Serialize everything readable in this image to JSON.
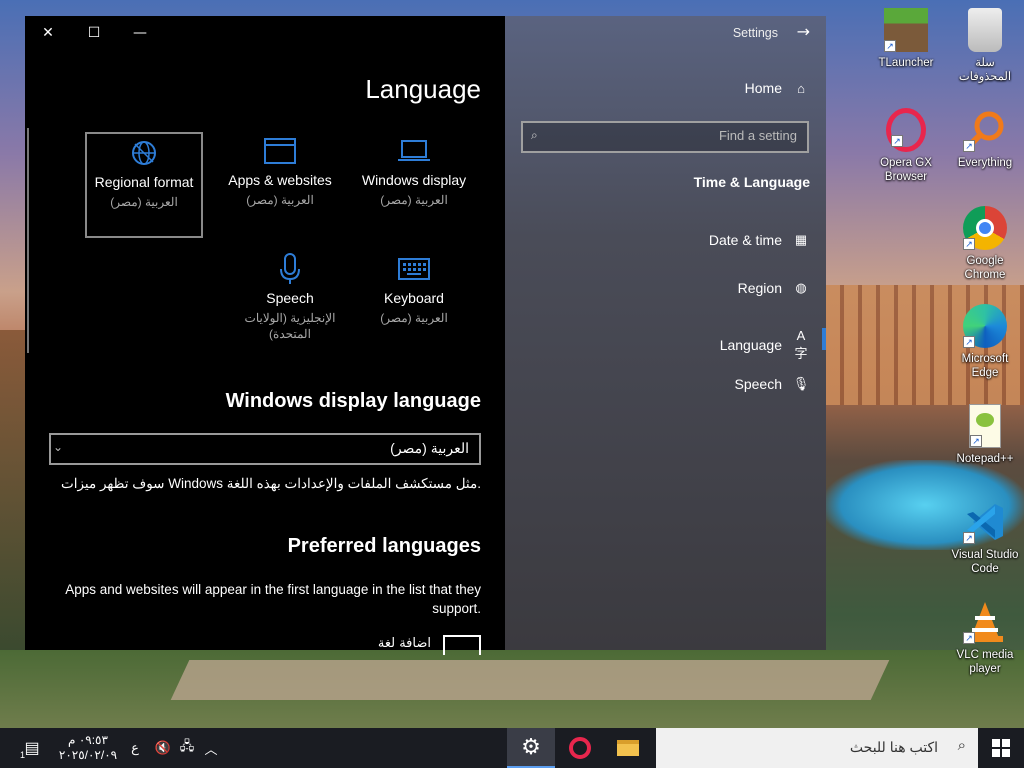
{
  "window": {
    "header_title": "Settings",
    "page_title": "Language",
    "controls": {
      "close": "✕",
      "maximize": "☐",
      "minimize": "—"
    }
  },
  "tiles": [
    {
      "name": "Regional format",
      "sub": "العربية (مصر)",
      "icon": "globe-icon"
    },
    {
      "name": "Apps & websites",
      "sub": "العربية (مصر)",
      "icon": "window-icon"
    },
    {
      "name": "Windows display",
      "sub": "العربية (مصر)",
      "icon": "laptop-icon"
    },
    {
      "name": "Speech",
      "sub": "الإنجليزية (الولايات المتحدة)",
      "icon": "microphone-icon"
    },
    {
      "name": "Keyboard",
      "sub": "العربية (مصر)",
      "icon": "keyboard-icon"
    }
  ],
  "display_language": {
    "heading": "Windows display language",
    "selected": "العربية (مصر)",
    "description": "سوف تظهر ميزات Windows مثل مستكشف الملفات والإعدادات بهذه اللغة."
  },
  "preferred": {
    "heading": "Preferred languages",
    "description": "Apps and websites will appear in the first language in the list that they support.",
    "add_label": "اضافة لغة"
  },
  "nav": {
    "home": "Home",
    "search_placeholder": "Find a setting",
    "section": "Time & Language",
    "items": [
      {
        "label": "Date & time",
        "icon": "calendar-clock-icon"
      },
      {
        "label": "Region",
        "icon": "globe-icon"
      },
      {
        "label": "Language",
        "icon": "language-icon"
      },
      {
        "label": "Speech",
        "icon": "microphone-icon"
      }
    ],
    "active": "Language"
  },
  "desktop_icons": [
    {
      "label": "TLauncher"
    },
    {
      "label": "سلة المحذوفات"
    },
    {
      "label": "Opera GX Browser"
    },
    {
      "label": "Everything"
    },
    {
      "label": "Google Chrome"
    },
    {
      "label": "Microsoft Edge"
    },
    {
      "label": "Notepad++"
    },
    {
      "label": "Visual Studio Code"
    },
    {
      "label": "VLC media player"
    }
  ],
  "taskbar": {
    "search_text": "اكتب هنا للبحث",
    "time": "٠٩:٥٣ م",
    "date": "٢٠٢٥/٠٢/٠٩",
    "lang_indicator": "ع",
    "notification_count": "1"
  },
  "colors": {
    "accent": "#2e7dd7",
    "window_bg": "#000000"
  }
}
